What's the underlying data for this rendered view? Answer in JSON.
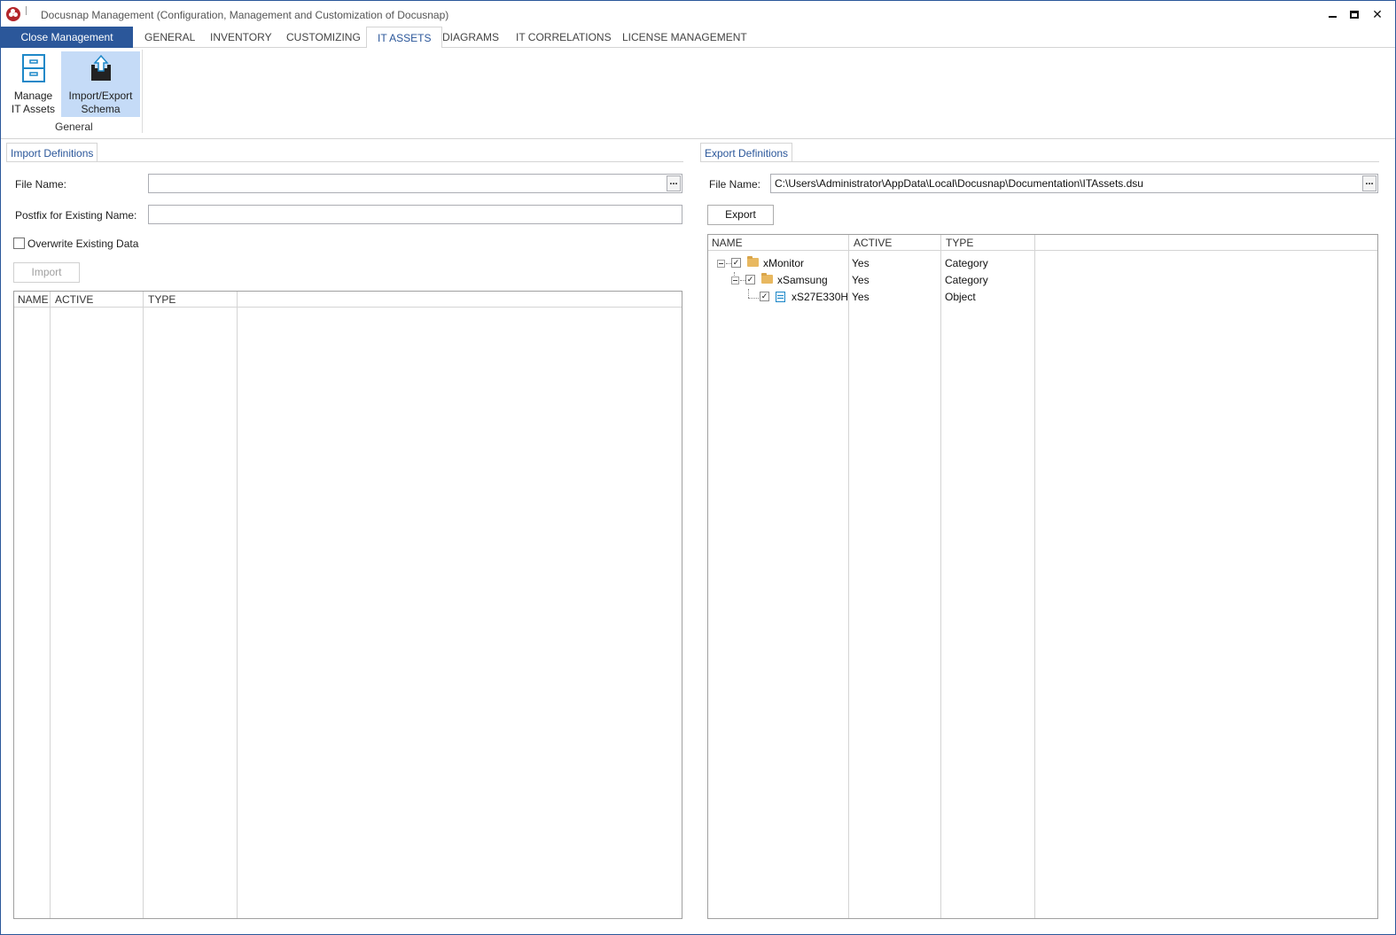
{
  "window": {
    "title": "Docusnap Management (Configuration, Management and Customization of Docusnap)"
  },
  "ribbon": {
    "file_tab": "Close Management",
    "tabs": [
      {
        "label": "GENERAL",
        "active": false
      },
      {
        "label": "INVENTORY",
        "active": false
      },
      {
        "label": "CUSTOMIZING",
        "active": false
      },
      {
        "label": "IT ASSETS",
        "active": true
      },
      {
        "label": "DIAGRAMS",
        "active": false
      },
      {
        "label": "IT CORRELATIONS",
        "active": false
      },
      {
        "label": "LICENSE MANAGEMENT",
        "active": false
      }
    ],
    "buttons": [
      {
        "label_line1": "Manage",
        "label_line2": "IT Assets",
        "icon": "cabinet-icon",
        "selected": false
      },
      {
        "label_line1": "Import/Export",
        "label_line2": "Schema",
        "icon": "upload-icon",
        "selected": true
      }
    ],
    "group_label": "General"
  },
  "import_panel": {
    "tab_label": "Import Definitions",
    "file_name_label": "File Name:",
    "file_name_value": "",
    "browse_label": "...",
    "postfix_label": "Postfix for Existing Name:",
    "postfix_value": "",
    "overwrite_label": "Overwrite Existing Data",
    "overwrite_checked": false,
    "import_button": "Import",
    "columns": [
      "NAME",
      "ACTIVE",
      "TYPE"
    ]
  },
  "export_panel": {
    "tab_label": "Export Definitions",
    "file_name_label": "File Name:",
    "file_name_value": "C:\\Users\\Administrator\\AppData\\Local\\Docusnap\\Documentation\\ITAssets.dsu",
    "browse_label": "...",
    "export_button": "Export",
    "columns": [
      "NAME",
      "ACTIVE",
      "TYPE"
    ],
    "rows": [
      {
        "name": "xMonitor",
        "active": "Yes",
        "type": "Category",
        "level": 0,
        "icon": "folder-icon",
        "checked": true
      },
      {
        "name": "xSamsung",
        "active": "Yes",
        "type": "Category",
        "level": 1,
        "icon": "folder-icon",
        "checked": true
      },
      {
        "name": "xS27E330H",
        "active": "Yes",
        "type": "Object",
        "level": 2,
        "icon": "object-icon",
        "checked": true
      }
    ]
  }
}
